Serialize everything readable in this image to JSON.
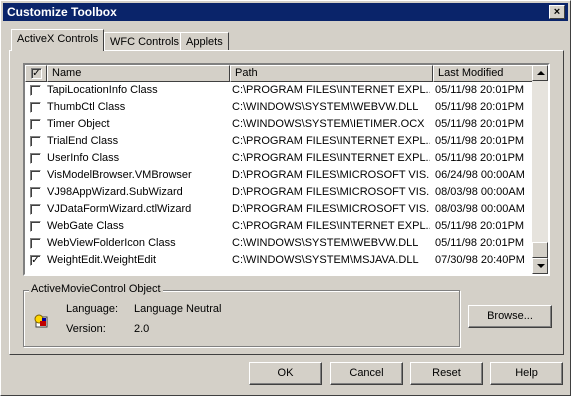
{
  "window": {
    "title": "Customize Toolbox",
    "close_symbol": "×"
  },
  "tabs": [
    {
      "label": "ActiveX Controls",
      "active": true
    },
    {
      "label": "WFC Controls",
      "active": false
    },
    {
      "label": "Applets",
      "active": false
    }
  ],
  "list": {
    "columns": {
      "check": "✓",
      "name": "Name",
      "path": "Path",
      "modified": "Last Modified"
    },
    "rows": [
      {
        "checked": false,
        "name": "TapiLocationInfo Class",
        "path": "C:\\PROGRAM FILES\\INTERNET EXPL...",
        "modified": "05/11/98 20:01PM"
      },
      {
        "checked": false,
        "name": "ThumbCtl Class",
        "path": "C:\\WINDOWS\\SYSTEM\\WEBVW.DLL",
        "modified": "05/11/98 20:01PM"
      },
      {
        "checked": false,
        "name": "Timer Object",
        "path": "C:\\WINDOWS\\SYSTEM\\IETIMER.OCX",
        "modified": "05/11/98 20:01PM"
      },
      {
        "checked": false,
        "name": "TrialEnd Class",
        "path": "C:\\PROGRAM FILES\\INTERNET EXPL...",
        "modified": "05/11/98 20:01PM"
      },
      {
        "checked": false,
        "name": "UserInfo Class",
        "path": "C:\\PROGRAM FILES\\INTERNET EXPL...",
        "modified": "05/11/98 20:01PM"
      },
      {
        "checked": false,
        "name": "VisModelBrowser.VMBrowser",
        "path": "D:\\PROGRAM FILES\\MICROSOFT VIS...",
        "modified": "06/24/98 00:00AM"
      },
      {
        "checked": false,
        "name": "VJ98AppWizard.SubWizard",
        "path": "D:\\PROGRAM FILES\\MICROSOFT VIS...",
        "modified": "08/03/98 00:00AM"
      },
      {
        "checked": false,
        "name": "VJDataFormWizard.ctlWizard",
        "path": "D:\\PROGRAM FILES\\MICROSOFT VIS...",
        "modified": "08/03/98 00:00AM"
      },
      {
        "checked": false,
        "name": "WebGate Class",
        "path": "C:\\PROGRAM FILES\\INTERNET EXPL...",
        "modified": "05/11/98 20:01PM"
      },
      {
        "checked": false,
        "name": "WebViewFolderIcon Class",
        "path": "C:\\WINDOWS\\SYSTEM\\WEBVW.DLL",
        "modified": "05/11/98 20:01PM"
      },
      {
        "checked": true,
        "name": "WeightEdit.WeightEdit",
        "path": "C:\\WINDOWS\\SYSTEM\\MSJAVA.DLL",
        "modified": "07/30/98 20:40PM"
      }
    ]
  },
  "details": {
    "group_title": "ActiveMovieControl Object",
    "icon": "activex-control-icon",
    "language_label": "Language:",
    "language_value": "Language Neutral",
    "version_label": "Version:",
    "version_value": "2.0",
    "browse_label": "Browse..."
  },
  "buttons": {
    "ok": "OK",
    "cancel": "Cancel",
    "reset": "Reset",
    "help": "Help"
  },
  "colors": {
    "titlebar": "#0a246a",
    "face": "#d4d0c8"
  }
}
